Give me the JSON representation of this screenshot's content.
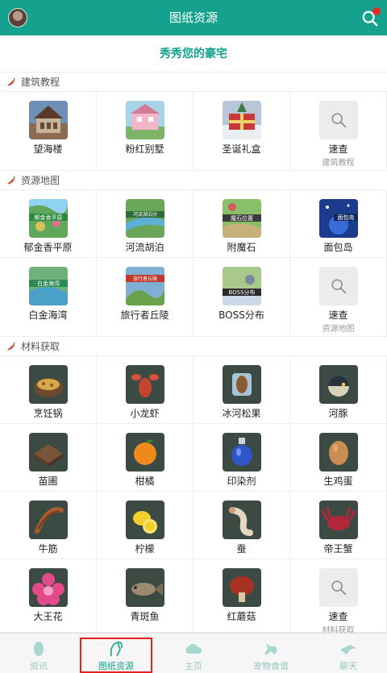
{
  "header": {
    "title": "图纸资源",
    "avatar_icon": "user-avatar",
    "search_icon": "search-icon"
  },
  "banner": {
    "text": "秀秀您的豪宅"
  },
  "sections": [
    {
      "title": "建筑教程",
      "items": [
        {
          "label": "望海楼",
          "icon": "mansion-image"
        },
        {
          "label": "粉红别墅",
          "icon": "pink-villa-image"
        },
        {
          "label": "圣诞礼盒",
          "icon": "christmas-box-image"
        },
        {
          "label": "速查",
          "sub": "建筑教程",
          "icon": "search-icon"
        }
      ]
    },
    {
      "title": "资源地图",
      "items": [
        {
          "label": "郁金香平原",
          "icon": "map-image",
          "badge": "郁金香平原"
        },
        {
          "label": "河流胡泊",
          "icon": "map-image",
          "badge": "河流湖泊分"
        },
        {
          "label": "附魔石",
          "icon": "map-image",
          "badge": "魔石位置"
        },
        {
          "label": "面包岛",
          "icon": "map-image",
          "badge": "面包岛"
        },
        {
          "label": "白金海湾",
          "icon": "map-image",
          "badge": "白金海湾"
        },
        {
          "label": "旅行者丘陵",
          "icon": "map-image",
          "badge": "旅行者丘陵"
        },
        {
          "label": "BOSS分布",
          "icon": "map-image",
          "badge": "BOSS分布"
        },
        {
          "label": "速查",
          "sub": "资源地图",
          "icon": "search-icon"
        }
      ]
    },
    {
      "title": "材料获取",
      "items": [
        {
          "label": "烹饪锅",
          "icon": "cooking-pot-image"
        },
        {
          "label": "小龙虾",
          "icon": "crayfish-image"
        },
        {
          "label": "冰河松果",
          "icon": "pinecone-image"
        },
        {
          "label": "河豚",
          "icon": "pufferfish-image"
        },
        {
          "label": "苗圃",
          "icon": "nursery-image"
        },
        {
          "label": "柑橘",
          "icon": "orange-image"
        },
        {
          "label": "印染剂",
          "icon": "dye-bottle-image"
        },
        {
          "label": "生鸡蛋",
          "icon": "egg-image"
        },
        {
          "label": "牛筋",
          "icon": "tendon-image"
        },
        {
          "label": "柠檬",
          "icon": "lemon-image"
        },
        {
          "label": "蚕",
          "icon": "silkworm-image"
        },
        {
          "label": "帝王蟹",
          "icon": "king-crab-image"
        },
        {
          "label": "大王花",
          "icon": "rafflesia-image"
        },
        {
          "label": "青斑鱼",
          "icon": "grouper-image"
        },
        {
          "label": "红蘑菇",
          "icon": "red-mushroom-image"
        },
        {
          "label": "速查",
          "sub": "材料获取",
          "icon": "search-icon"
        }
      ]
    }
  ],
  "nav": [
    {
      "label": "资讯",
      "icon": "egg-icon"
    },
    {
      "label": "图纸资源",
      "icon": "blueprint-icon",
      "active": true
    },
    {
      "label": "主页",
      "icon": "cloud-icon"
    },
    {
      "label": "宠物食谱",
      "icon": "pet-icon"
    },
    {
      "label": "聊天",
      "icon": "bird-icon"
    }
  ],
  "colors": {
    "accent": "#14a28e",
    "highlight": "#e62020",
    "notification": "#e32b2b"
  }
}
